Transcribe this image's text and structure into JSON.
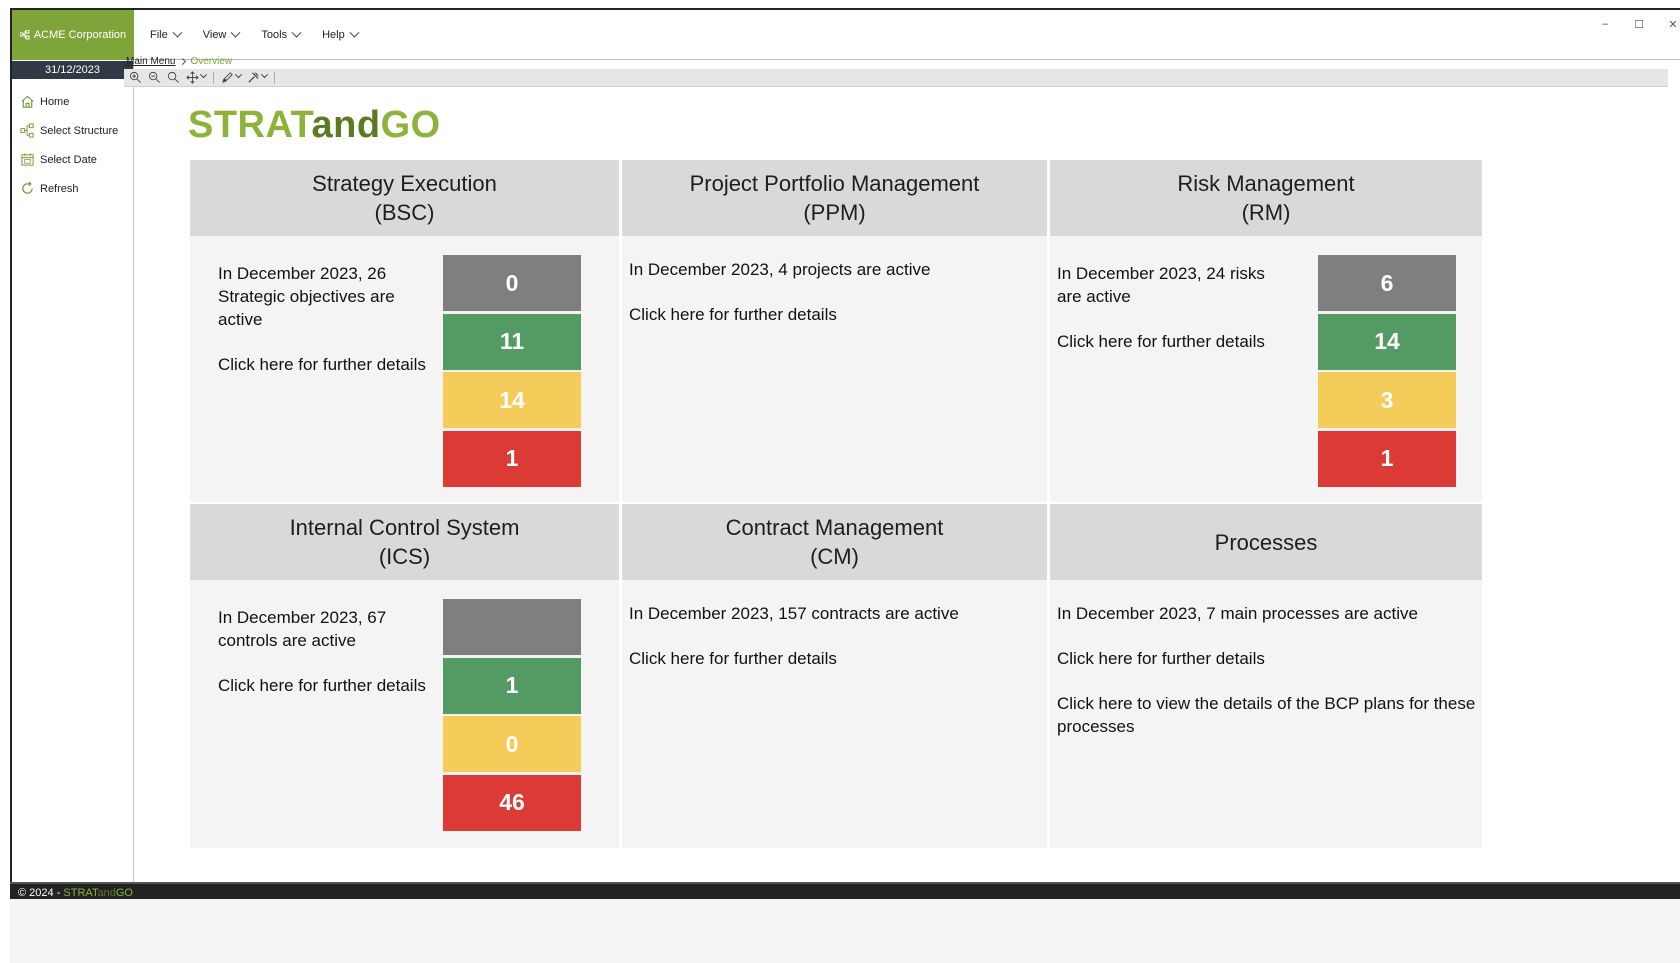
{
  "app": {
    "company": "ACME Corporation",
    "date": "31/12/2023"
  },
  "menu": [
    {
      "label": "File"
    },
    {
      "label": "View"
    },
    {
      "label": "Tools"
    },
    {
      "label": "Help"
    }
  ],
  "window_controls": {
    "minimize": "–",
    "maximize": "☐",
    "close": "✕"
  },
  "sidebar": {
    "items": [
      {
        "label": "Home",
        "icon": "home-icon"
      },
      {
        "label": "Select Structure",
        "icon": "structure-icon"
      },
      {
        "label": "Select Date",
        "icon": "calendar-icon"
      },
      {
        "label": "Refresh",
        "icon": "refresh-icon"
      }
    ]
  },
  "breadcrumb": {
    "root": "Main Menu",
    "current": "Overview"
  },
  "logo": {
    "part1": "STRAT",
    "part2": "and",
    "part3": "GO"
  },
  "status_colors": {
    "neutral": "#7f7f7f",
    "green": "#539a63",
    "yellow": "#f5cb5a",
    "red": "#db3a35"
  },
  "panels": {
    "bsc": {
      "title": "Strategy Execution",
      "abbr": "(BSC)",
      "summary": "In December 2023, 26 Strategic objectives are active",
      "details_link": "Click here for further details",
      "counts": {
        "neutral": "0",
        "green": "11",
        "yellow": "14",
        "red": "1"
      }
    },
    "ppm": {
      "title": "Project Portfolio Management",
      "abbr": "(PPM)",
      "summary": "In December 2023, 4 projects are active",
      "details_link": "Click here for further details"
    },
    "rm": {
      "title": "Risk Management",
      "abbr": "(RM)",
      "summary": "In December 2023, 24 risks are active",
      "details_link": "Click here for further details",
      "counts": {
        "neutral": "6",
        "green": "14",
        "yellow": "3",
        "red": "1"
      }
    },
    "ics": {
      "title": "Internal Control System",
      "abbr": "(ICS)",
      "summary": "In December 2023, 67 controls are active",
      "details_link": "Click here for further details",
      "counts": {
        "neutral": "",
        "green": "1",
        "yellow": "0",
        "red": "46"
      }
    },
    "cm": {
      "title": "Contract Management",
      "abbr": "(CM)",
      "summary": "In December 2023, 157 contracts are active",
      "details_link": "Click here for further details"
    },
    "processes": {
      "title": "Processes",
      "summary": "In December 2023, 7 main processes are active",
      "details_link": "Click here for further details",
      "bcp_link": "Click here to view the details of the BCP plans for these processes"
    }
  },
  "footer": {
    "copyright": "© 2024 - ",
    "brand_part1": "STRAT",
    "brand_part2": "and",
    "brand_part3": "GO"
  }
}
